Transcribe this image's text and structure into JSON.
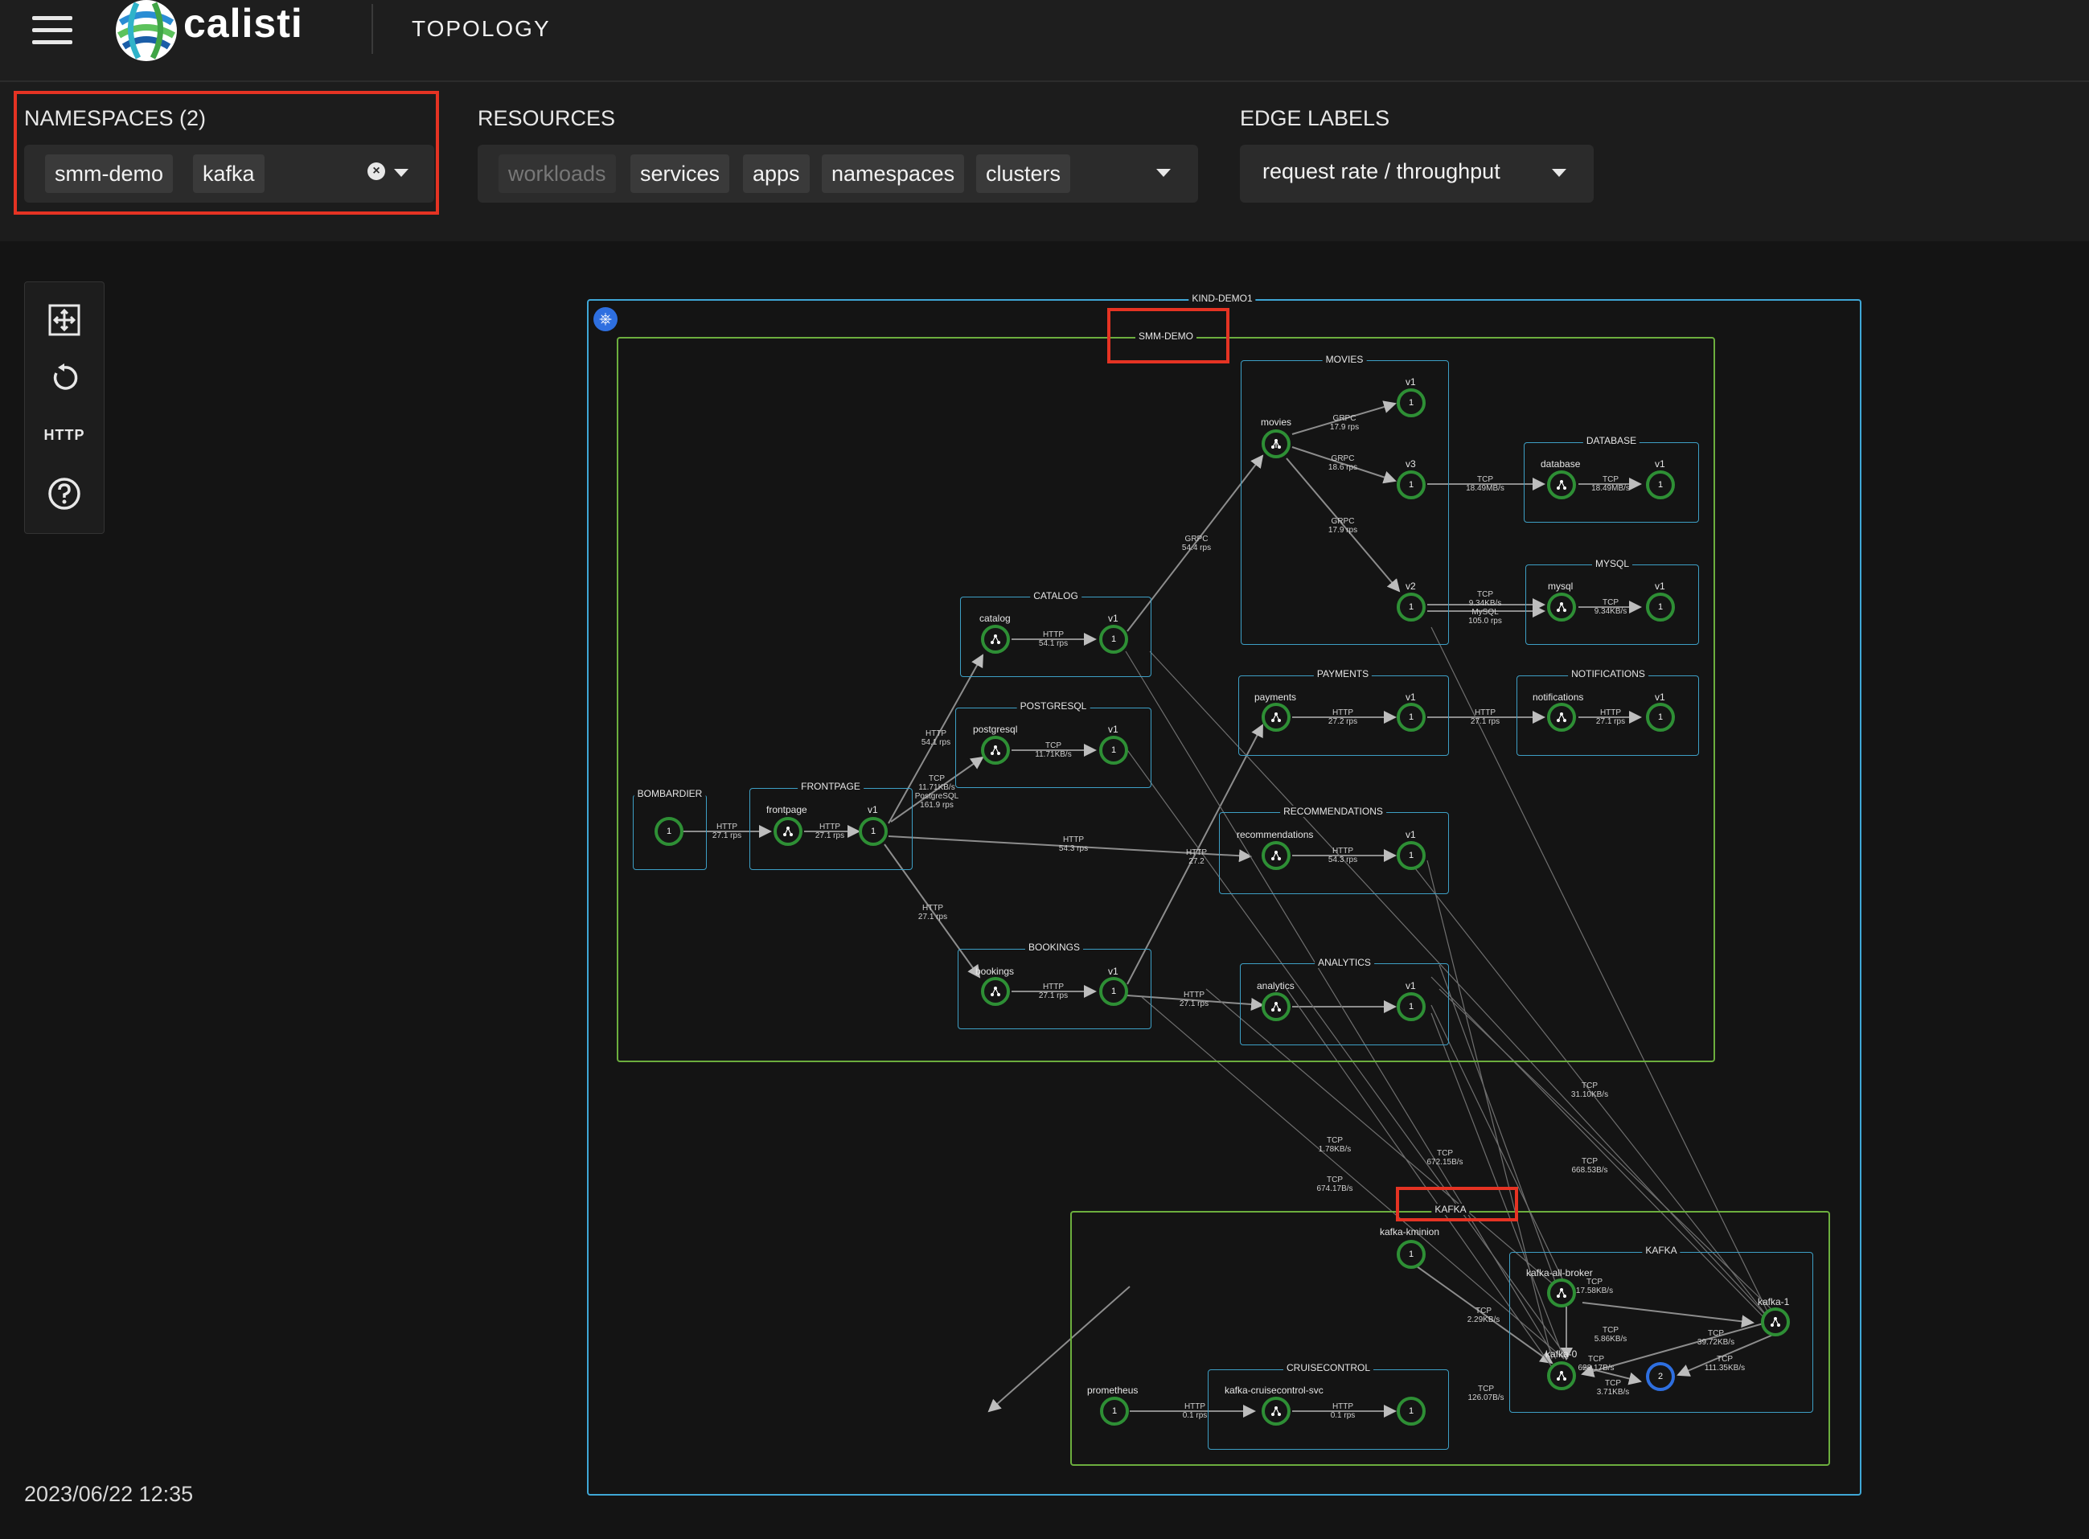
{
  "header": {
    "brand": "calisti",
    "section": "TOPOLOGY"
  },
  "filters": {
    "namespaces": {
      "label": "NAMESPACES (2)",
      "chips": [
        "smm-demo",
        "kafka"
      ]
    },
    "resources": {
      "label": "RESOURCES",
      "chips": [
        "workloads",
        "services",
        "apps",
        "namespaces",
        "clusters"
      ]
    },
    "edge_labels": {
      "label": "EDGE LABELS",
      "value": "request rate / throughput"
    }
  },
  "toolbar": {
    "http_label": "HTTP"
  },
  "timestamp": "2023/06/22 12:35",
  "graph": {
    "cluster": "KIND-DEMO1",
    "ns_smm": "SMM-DEMO",
    "ns_kafka": "KAFKA",
    "groups": {
      "movies": "MOVIES",
      "database": "DATABASE",
      "mysql": "MYSQL",
      "catalog": "CATALOG",
      "postgresql": "POSTGRESQL",
      "payments": "PAYMENTS",
      "notifications": "NOTIFICATIONS",
      "frontpage": "FRONTPAGE",
      "bombardier": "BOMBARDIER",
      "recommendations": "RECOMMENDATIONS",
      "bookings": "BOOKINGS",
      "analytics": "ANALYTICS",
      "kafka_group": "KAFKA",
      "cruisecontrol": "CRUISECONTROL"
    },
    "names": {
      "movies": "movies",
      "database": "database",
      "mysql": "mysql",
      "catalog": "catalog",
      "postgresql": "postgresql",
      "payments": "payments",
      "notifications": "notifications",
      "frontpage": "frontpage",
      "recommendations": "recommendations",
      "bookings": "bookings",
      "analytics": "analytics",
      "kafka_kminion": "kafka-kminion",
      "kafka_all_broker": "kafka-all-broker",
      "kafka_0": "kafka-0",
      "kafka_1": "kafka-1",
      "prometheus": "prometheus",
      "kafka_cc_svc": "kafka-cruisecontrol-svc",
      "v1": "v1",
      "v2": "v2",
      "v3": "v3"
    },
    "counts": {
      "one": "1",
      "two": "2"
    },
    "edges": {
      "bomb_front": "HTTP\n27.1 rps",
      "front_v1": "HTTP\n27.1 rps",
      "front_catalog": "HTTP\n54.1 rps",
      "front_pg": "TCP\n11.71KB/s\nPostgreSQL\n161.9 rps",
      "front_reco": "HTTP\n54.3 rps",
      "front_bookings": "HTTP\n27.1 rps",
      "catalog_v1": "HTTP\n54.1 rps",
      "catalog_movies": "GRPC\n54.4 rps",
      "pg_v1": "TCP\n11.71KB/s",
      "movies_v1": "GRPC\n17.9 rps",
      "movies_v3": "GRPC\n18.6 rps",
      "movies_v2": "GRPC\n17.9 rps",
      "v3_db": "TCP\n18.49MB/s",
      "db_v1": "TCP\n18.49MB/s",
      "v2_mysql": "TCP\n9.34KB/s\nMySQL\n105.0 rps",
      "mysql_v1": "TCP\n9.34KB/s",
      "payments_v1": "HTTP\n27.2 rps",
      "pay_notif": "HTTP\n27.1 rps",
      "notif_v1": "HTTP\n27.1 rps",
      "reco_v1": "HTTP\n54.3 rps",
      "bookings_v1": "HTTP\n27.1 rps",
      "bookings_analytics": "HTTP\n27.1 rps",
      "bookings_payments": "HTTP\n27.2",
      "k1": "TCP\n1.78KB/s",
      "k2": "TCP\n674.17B/s",
      "k3": "TCP\n672.15B/s",
      "k4": "TCP\n31.10KB/s",
      "k5": "TCP\n668.53B/s",
      "kafka_broker": "TCP\n17.58KB/s",
      "kafka_b2": "TCP\n5.86KB/s",
      "kafka_0_lbl": "TCP\n628.17B/s",
      "kafka_mid": "TCP\n3.71KB/s",
      "kafka_1a": "TCP\n39.72KB/s",
      "kafka_1b": "TCP\n111.35KB/s",
      "kminion": "TCP\n2.29KB/s",
      "cc_kafka": "TCP\n126.07B/s",
      "prom_cc": "HTTP\n0.1 rps",
      "cc_v1": "HTTP\n0.1 rps"
    }
  }
}
